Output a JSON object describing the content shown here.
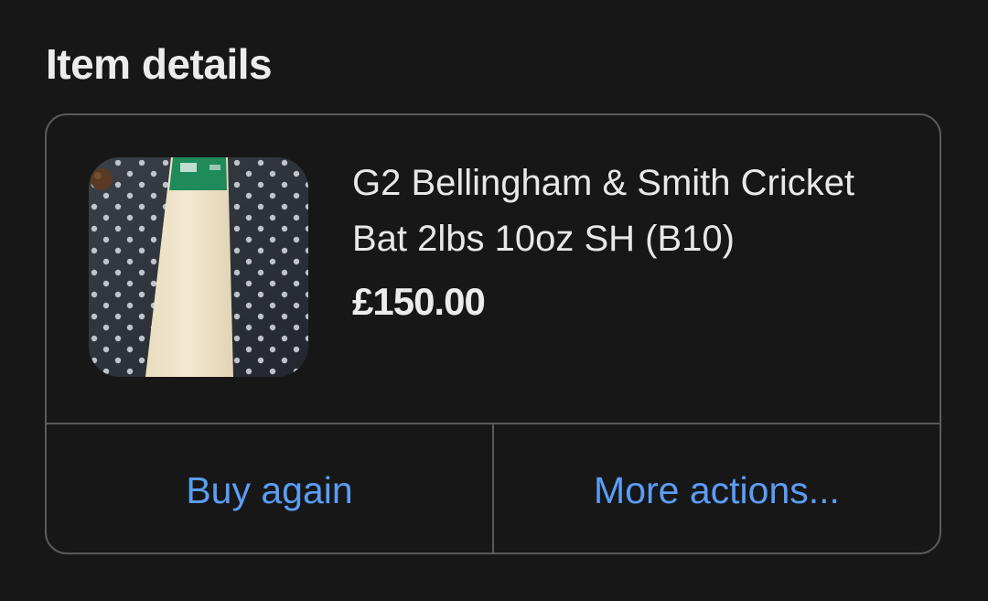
{
  "section": {
    "title": "Item details"
  },
  "item": {
    "title": "G2 Bellingham & Smith Cricket Bat 2lbs 10oz SH (B10)",
    "price": "£150.00",
    "image": "cricket-bat-photo"
  },
  "actions": {
    "buy_again_label": "Buy again",
    "more_actions_label": "More actions..."
  },
  "colors": {
    "background": "#171718",
    "border": "#5a5a5c",
    "link": "#5b9df5",
    "text": "#e8e8e8"
  }
}
